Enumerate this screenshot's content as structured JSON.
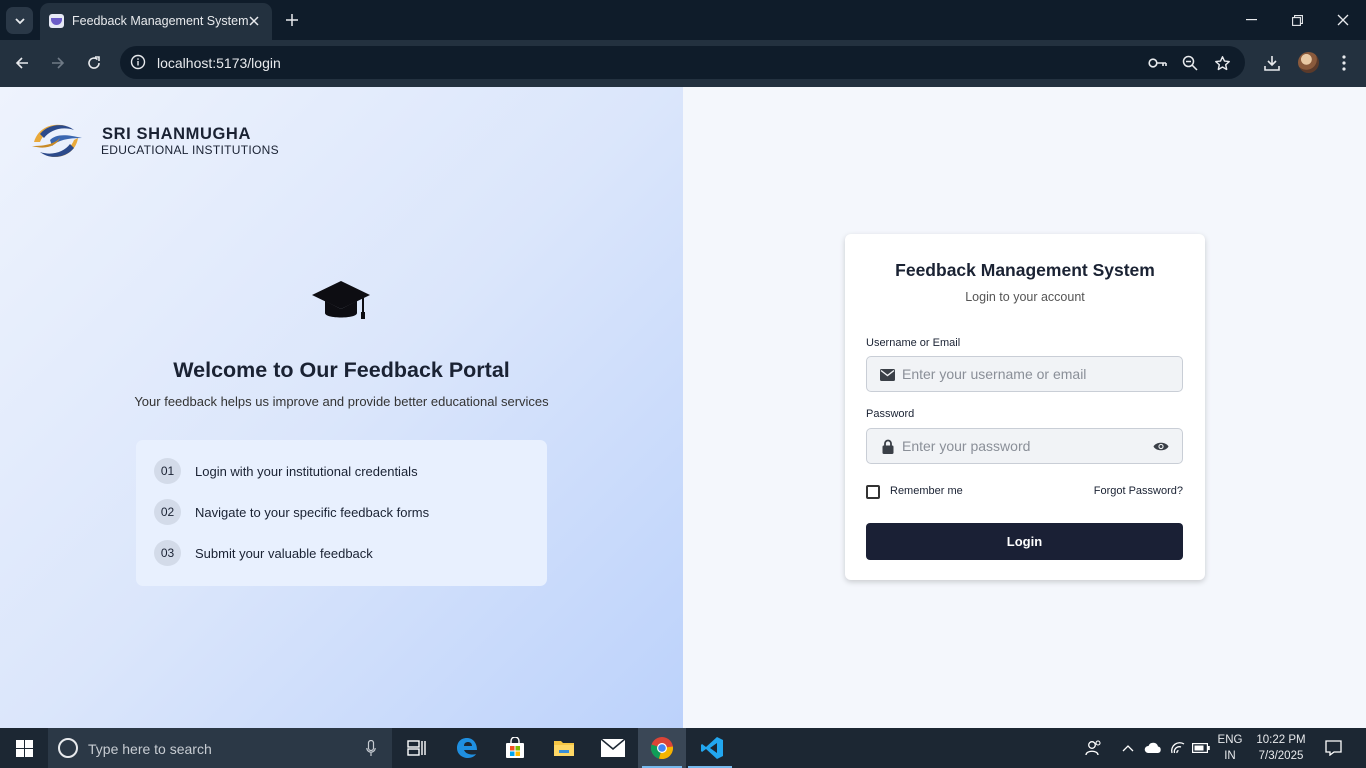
{
  "browser": {
    "tab_title": "Feedback Management System",
    "url": "localhost:5173/login"
  },
  "institution": {
    "name": "SRI SHANMUGHA",
    "subtitle": "EDUCATIONAL INSTITUTIONS"
  },
  "welcome": {
    "title": "Welcome to Our Feedback Portal",
    "subtitle": "Your feedback helps us improve and provide better educational services",
    "steps": [
      {
        "num": "01",
        "text": "Login with your institutional credentials"
      },
      {
        "num": "02",
        "text": "Navigate to your specific feedback forms"
      },
      {
        "num": "03",
        "text": "Submit your valuable feedback"
      }
    ]
  },
  "login_card": {
    "title": "Feedback Management System",
    "subtitle": "Login to your account",
    "username_label": "Username or Email",
    "username_placeholder": "Enter your username or email",
    "password_label": "Password",
    "password_placeholder": "Enter your password",
    "remember_label": "Remember me",
    "forgot_label": "Forgot Password?",
    "login_button": "Login"
  },
  "taskbar": {
    "search_placeholder": "Type here to search",
    "language": "ENG",
    "region": "IN",
    "time": "10:22 PM",
    "date": "7/3/2025"
  },
  "colors": {
    "primary_button": "#1a2035",
    "left_gradient_end": "#bcd2fb",
    "chrome_dark": "#0f1c2a"
  }
}
